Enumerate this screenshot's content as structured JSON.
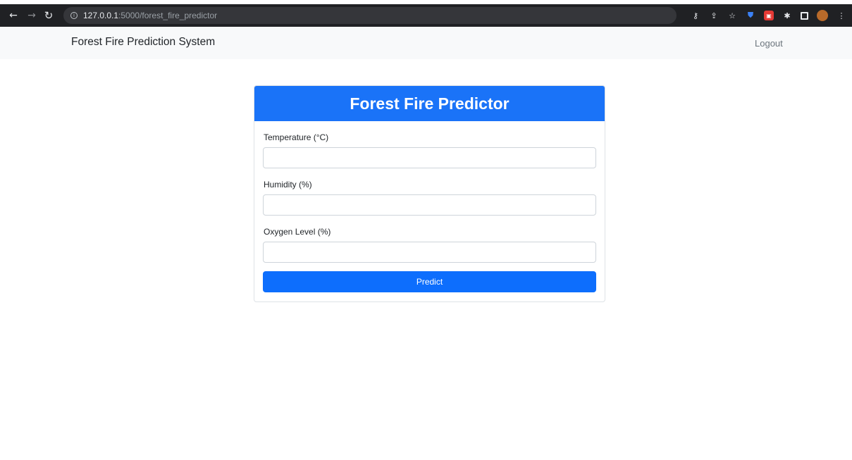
{
  "browser": {
    "url_host": "127.0.0.1",
    "url_path": ":5000/forest_fire_predictor"
  },
  "navbar": {
    "brand": "Forest Fire Prediction System",
    "logout_label": "Logout"
  },
  "card": {
    "title": "Forest Fire Predictor",
    "fields": [
      {
        "label": "Temperature (°C)",
        "value": "",
        "placeholder": ""
      },
      {
        "label": "Humidity (%)",
        "value": "",
        "placeholder": ""
      },
      {
        "label": "Oxygen Level (%)",
        "value": "",
        "placeholder": ""
      }
    ],
    "submit_label": "Predict"
  },
  "icons": {
    "back": "arrow-left-icon",
    "forward": "arrow-right-icon",
    "reload": "reload-icon",
    "site_info": "info-icon",
    "key": "key-icon",
    "share": "share-icon",
    "bookmark": "star-icon",
    "extension_shield": "shield-icon",
    "extension_red": "extension-icon",
    "extensions": "puzzle-icon",
    "side_panel": "side-panel-icon",
    "profile": "avatar",
    "menu": "kebab-menu-icon"
  },
  "colors": {
    "primary": "#0d6efd",
    "header_blue": "#1a73f8",
    "navbar_bg": "#f8f9fa",
    "browser_bg": "#202124"
  }
}
